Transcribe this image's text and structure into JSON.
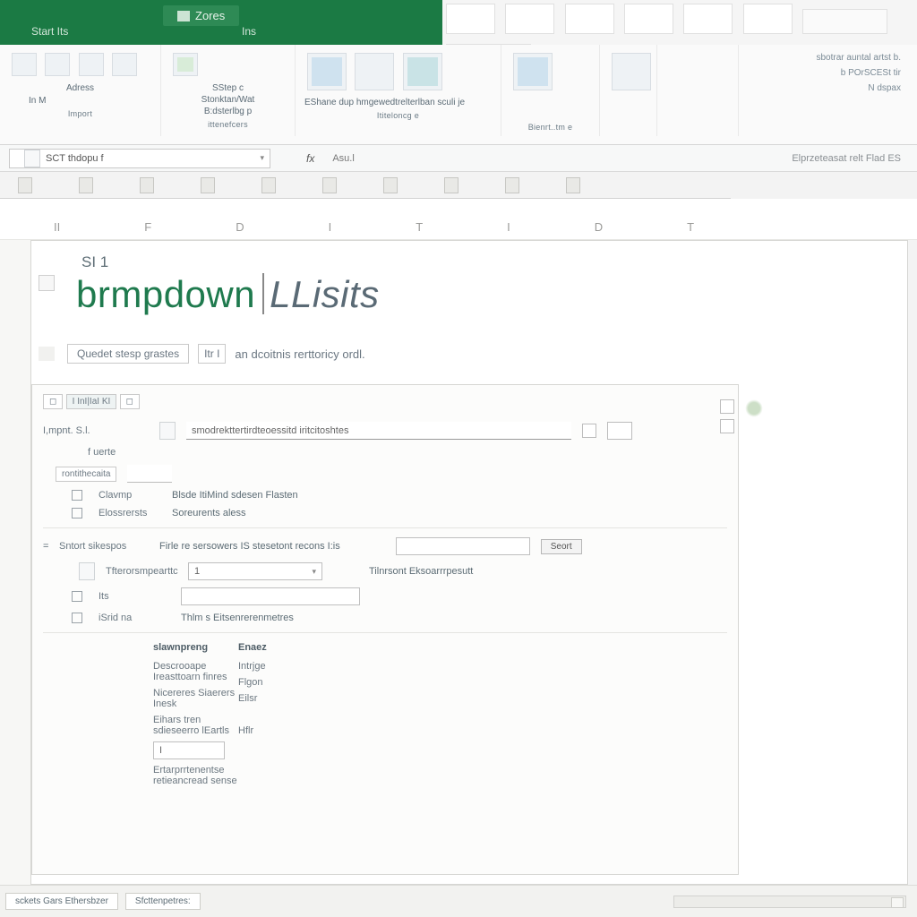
{
  "titlebar": {
    "tab_left": "Start Its",
    "tab_active": "Zores",
    "tab_right": "Ins"
  },
  "ribbon_groups": {
    "g1_caption": "Import",
    "g1_item1": "Adress",
    "g1_item2": "In M",
    "g2_item1": "SStep c",
    "g2_item2": "Stonktan/Wat",
    "g2_item3": "B:dsterlbg p",
    "g2_item4": "ittenefcers",
    "g3_item1": "EShane dup hmgewedtrelterlban sculi je",
    "g3_item2": "Ititeloncg e",
    "g4_caption": "Bienrt..tm e",
    "right_1": "sbotrar auntal artst b.",
    "right_2": "b POrSCESt tir",
    "right_3": "N dspax"
  },
  "fbar": {
    "namebox": "SCT thdopu f",
    "fx": "fx",
    "text": "Asu.l",
    "right": "Elprzeteasat relt Flad ES"
  },
  "columns": [
    "II",
    "F",
    "D",
    "I",
    "T",
    "I",
    "D",
    "T"
  ],
  "sheet": {
    "s1": "SI 1",
    "title_a": "brmpdown",
    "title_b": "LLisits",
    "under_btn1": "Quedet stesp grastes",
    "under_btn2": "Itr I",
    "under_text": "an dcoitnis rerttoricy ordl."
  },
  "panel": {
    "tab1": "I InI|IaI KI",
    "header_input": "smodrekttertirdteoessitd iritcitoshtes",
    "row1_label": "I,mpnt. S.l.",
    "row1b_label": "f uerte",
    "row2_label": "rontithecaita",
    "row3_check_label": "Clavmp",
    "row3_value": "Blsde ItiMind sdesen Flasten",
    "row4_check_label": "Elossrersts",
    "row4_value": "Soreurents aless",
    "sec_label": "Sntort sikespos",
    "sec_text": "Firle re sersowers IS stesetont recons I:is",
    "sec_btn": "Seort",
    "opt1_label": "Tfterorsmpearttc",
    "opt1_val": "1",
    "opt1_right": "Tilnrsont Eksoarrrpesutt",
    "opt2_label": "Its",
    "opt3_label": "iSrid na",
    "opt3_val": "Thlm s Eitsenrerenmetres",
    "col1_h": "slawnpreng",
    "col1_a": "Descrooape Ireasttoarn finres",
    "col1_b": "Nicereres Siaerers Inesk",
    "col1_c": "Eihars tren sdieseerro lEartls",
    "col1_d_input": "I",
    "col1_e": "Ertarprrtenentse retieancread sense",
    "col2_h": "Enaez",
    "col2_a": "Intrjge",
    "col2_b": "Flgon",
    "col2_c": "Eilsr",
    "col2_e": "Hflr"
  },
  "bottom": {
    "tab1": "sckets Gars Ethersbzer",
    "tab2": "Sfcttenpetres:"
  }
}
